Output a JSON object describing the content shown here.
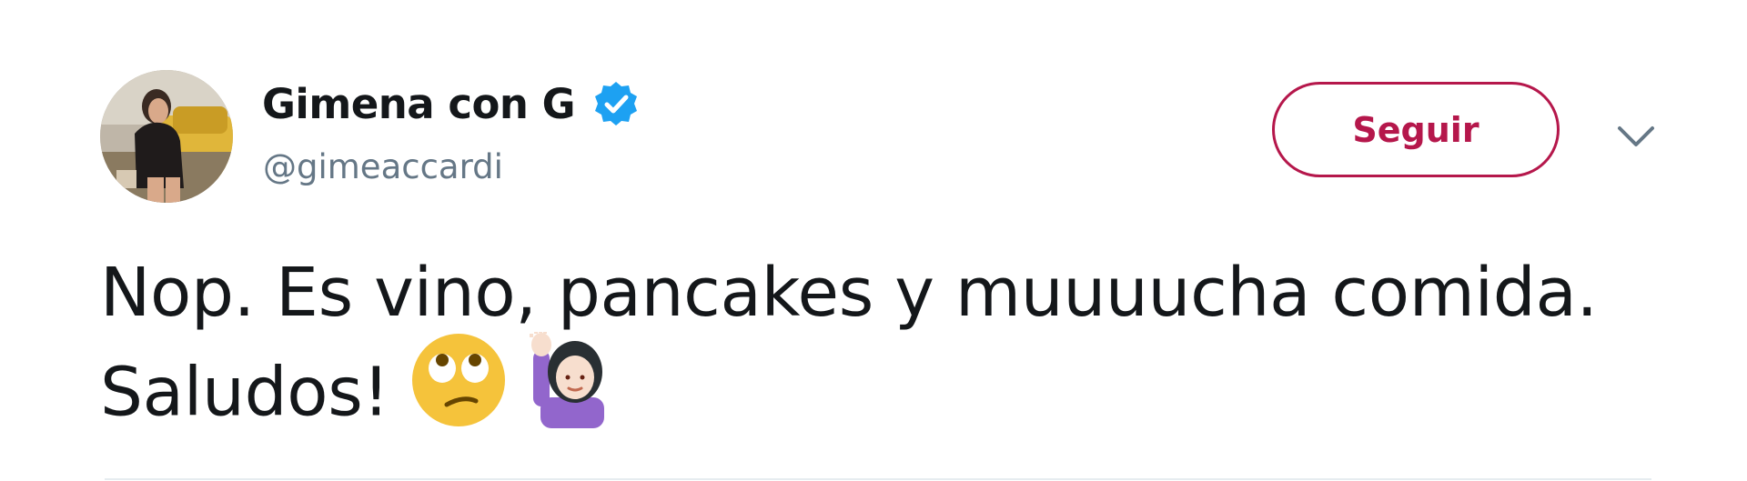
{
  "tweet": {
    "author": {
      "display_name": "Gimena con G",
      "handle": "@gimeaccardi",
      "verified": true
    },
    "follow_label": "Seguir",
    "text_lines": [
      "Nop. Es vino, pancakes y muuuucha comida.",
      "Saludos!"
    ],
    "emojis": [
      "face-with-rolling-eyes-emoji",
      "person-raising-hand-emoji"
    ],
    "colors": {
      "accent": "#b5174b",
      "verified": "#1da1f2",
      "handle": "#657786",
      "text": "#14171a"
    }
  }
}
